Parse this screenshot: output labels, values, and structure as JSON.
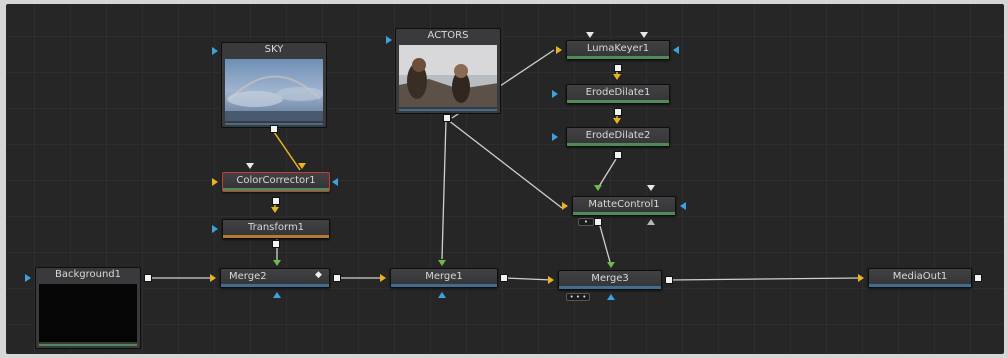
{
  "nodes": {
    "sky": "SKY",
    "actors": "ACTORS",
    "lumakeyer": "LumaKeyer1",
    "erodedilate1": "ErodeDilate1",
    "erodedilate2": "ErodeDilate2",
    "colorcorrector": "ColorCorrector1",
    "transform": "Transform1",
    "mattecontrol": "MatteControl1",
    "background": "Background1",
    "merge2": "Merge2",
    "merge1": "Merge1",
    "merge3": "Merge3",
    "mediaout": "MediaOut1"
  },
  "icons": {
    "merge2_extra": "diamond-icon",
    "chip": "ellipsis-icon"
  },
  "colors": {
    "canvas": "#262627",
    "link": "#cfcfcf",
    "highlight_link": "#e8b520",
    "input_blue": "#3aa4e0",
    "input_gold": "#e8b520",
    "input_green": "#6cba48",
    "selected_border": "#c43c32"
  }
}
